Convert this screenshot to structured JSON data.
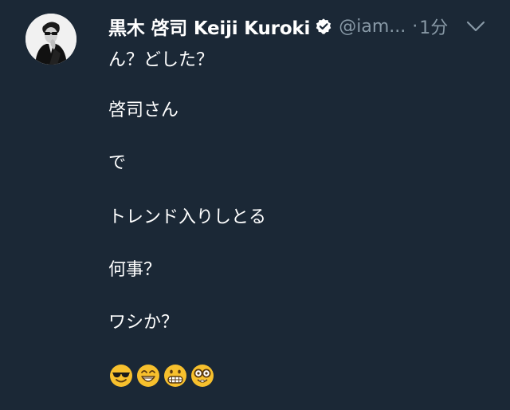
{
  "tweet": {
    "author": {
      "display_name": "黒木 啓司 Keiji Kuroki",
      "handle": "@iam...",
      "verified": true
    },
    "separator": "·",
    "timestamp": "1分",
    "lines": [
      "ん？どした？",
      "啓司さん",
      "で",
      "トレンド入りしとる",
      "何事？",
      "ワシか？"
    ],
    "emojis": [
      "smiling-face-with-sunglasses",
      "grinning-face-with-smiling-eyes",
      "grimacing-face",
      "nerd-face"
    ]
  },
  "colors": {
    "background": "#1b2836",
    "text": "#ffffff",
    "secondary": "#8899a6",
    "emoji_yellow": "#f7c02d"
  }
}
